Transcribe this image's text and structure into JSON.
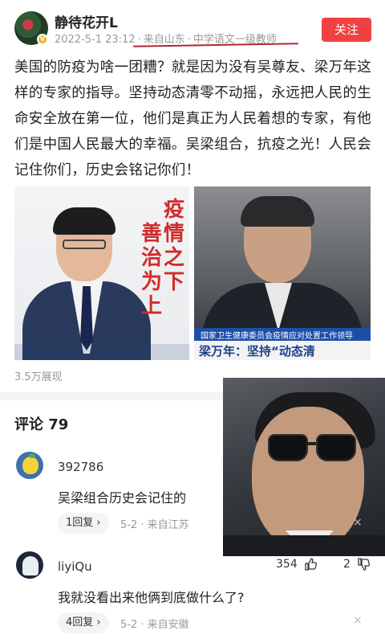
{
  "header": {
    "username": "静待花开L",
    "badge": "V",
    "date": "2022-5-1 23:12",
    "location": "来自山东",
    "title_tag": "中学语文一级教师",
    "follow_label": "关注"
  },
  "post": {
    "text": "美国的防疫为啥一团糟？就是因为没有吴尊友、梁万年这样的专家的指导。坚持动态清零不动摇，永远把人民的生命安全放在第一位，他们是真正为人民着想的专家，有他们是中国人民最大的幸福。吴梁组合，抗疫之光！人民会记住你们，历史会铭记你们！",
    "image_left": {
      "calligraphy_col1": [
        "疫",
        "情",
        "之",
        "下"
      ],
      "calligraphy_col2": [
        "善",
        "治",
        "为",
        "上"
      ]
    },
    "image_right": {
      "news_banner": "国家卫生健康委员会疫情应对处置工作领导",
      "news_caption": "梁万年：坚持“动态清"
    },
    "views": "3.5万展现"
  },
  "comments": {
    "title": "评论 79",
    "items": [
      {
        "name": "392786",
        "text": "吴梁组合历史会记住的",
        "reply_label": "1回复 ›",
        "meta": "5-2 · 来自江苏",
        "close": "×"
      },
      {
        "name": "liyiQu",
        "text": "我就没看出来他俩到底做什么了?",
        "reply_label": "4回复 ›",
        "meta": "5-2 · 来自安徽",
        "likes": "354",
        "dislikes": "2",
        "close": "×"
      }
    ]
  },
  "colors": {
    "accent": "#f04142",
    "underline": "#b0263a",
    "meta_gray": "#999999",
    "calligraphy_red": "#d12b2b",
    "news_blue": "#1d4fa8"
  },
  "icons": [
    "verified-badge-icon",
    "thumbs-up-icon",
    "thumbs-down-icon",
    "chevron-right-icon",
    "close-icon"
  ]
}
